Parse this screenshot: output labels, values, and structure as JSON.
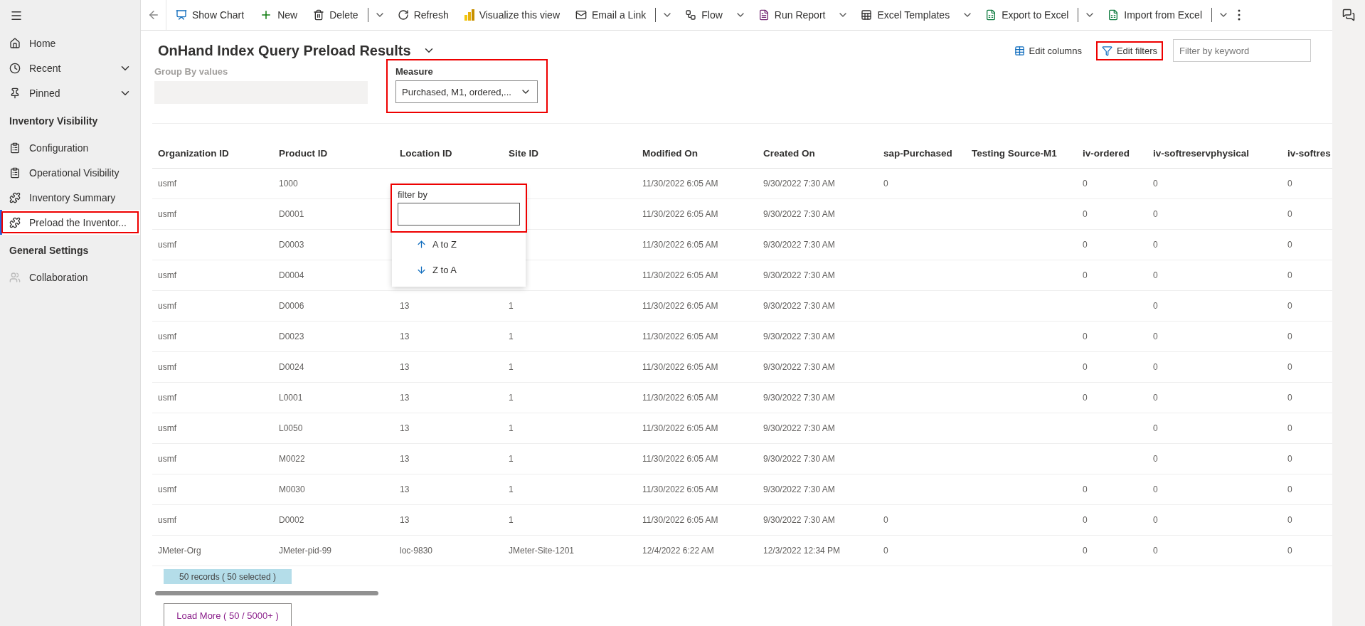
{
  "sidebar": {
    "items": [
      {
        "label": "Home",
        "expandable": false,
        "selected": false,
        "highlighted": false
      },
      {
        "label": "Recent",
        "expandable": true,
        "selected": false,
        "highlighted": false
      },
      {
        "label": "Pinned",
        "expandable": true,
        "selected": false,
        "highlighted": false
      }
    ],
    "sections": [
      {
        "title": "Inventory Visibility",
        "items": [
          {
            "label": "Configuration",
            "selected": false,
            "highlighted": false
          },
          {
            "label": "Operational Visibility",
            "selected": false,
            "highlighted": false
          },
          {
            "label": "Inventory Summary",
            "selected": false,
            "highlighted": false
          },
          {
            "label": "Preload the Inventor...",
            "selected": true,
            "highlighted": true
          }
        ]
      },
      {
        "title": "General Settings",
        "items": [
          {
            "label": "Collaboration",
            "selected": false,
            "highlighted": false
          }
        ]
      }
    ]
  },
  "toolbar": [
    {
      "label": "Show Chart",
      "caret": false,
      "divider": false
    },
    {
      "label": "New",
      "caret": false,
      "divider": false
    },
    {
      "label": "Delete",
      "caret": true,
      "divider": true
    },
    {
      "label": "Refresh",
      "caret": false,
      "divider": false
    },
    {
      "label": "Visualize this view",
      "caret": false,
      "divider": false
    },
    {
      "label": "Email a Link",
      "caret": true,
      "divider": true
    },
    {
      "label": "Flow",
      "caret": true,
      "divider": false
    },
    {
      "label": "Run Report",
      "caret": true,
      "divider": false
    },
    {
      "label": "Excel Templates",
      "caret": true,
      "divider": false
    },
    {
      "label": "Export to Excel",
      "caret": true,
      "divider": true
    },
    {
      "label": "Import from Excel",
      "caret": true,
      "divider": true
    }
  ],
  "view": {
    "title": "OnHand Index Query Preload Results",
    "edit_columns": "Edit columns",
    "edit_filters": {
      "label": "Edit filters",
      "highlighted": true
    },
    "search": {
      "placeholder": "Filter by keyword"
    }
  },
  "group_by": {
    "label": "Group By values",
    "disabled": true
  },
  "measure": {
    "label": "Measure",
    "value": "Purchased, M1, ordered,...",
    "highlighted": true
  },
  "table": {
    "columns": [
      "Organization ID",
      "Product ID",
      "Location ID",
      "Site ID",
      "Modified On",
      "Created On",
      "sap-Purchased",
      "Testing Source-M1",
      "iv-ordered",
      "iv-softreservphysical",
      "iv-softres"
    ],
    "rows": [
      {
        "cells": [
          "usmf",
          "1000",
          null,
          null,
          "11/30/2022 6:05 AM",
          "9/30/2022 7:30 AM",
          "0",
          null,
          "0",
          "0",
          "0"
        ]
      },
      {
        "cells": [
          "usmf",
          "D0001",
          null,
          null,
          "11/30/2022 6:05 AM",
          "9/30/2022 7:30 AM",
          null,
          null,
          "0",
          "0",
          "0"
        ]
      },
      {
        "cells": [
          "usmf",
          "D0003",
          null,
          null,
          "11/30/2022 6:05 AM",
          "9/30/2022 7:30 AM",
          null,
          null,
          "0",
          "0",
          "0"
        ]
      },
      {
        "cells": [
          "usmf",
          "D0004",
          null,
          null,
          "11/30/2022 6:05 AM",
          "9/30/2022 7:30 AM",
          null,
          null,
          "0",
          "0",
          "0"
        ]
      },
      {
        "cells": [
          "usmf",
          "D0006",
          "13",
          "1",
          "11/30/2022 6:05 AM",
          "9/30/2022 7:30 AM",
          null,
          null,
          null,
          "0",
          "0"
        ]
      },
      {
        "cells": [
          "usmf",
          "D0023",
          "13",
          "1",
          "11/30/2022 6:05 AM",
          "9/30/2022 7:30 AM",
          null,
          null,
          "0",
          "0",
          "0"
        ]
      },
      {
        "cells": [
          "usmf",
          "D0024",
          "13",
          "1",
          "11/30/2022 6:05 AM",
          "9/30/2022 7:30 AM",
          null,
          null,
          "0",
          "0",
          "0"
        ]
      },
      {
        "cells": [
          "usmf",
          "L0001",
          "13",
          "1",
          "11/30/2022 6:05 AM",
          "9/30/2022 7:30 AM",
          null,
          null,
          "0",
          "0",
          "0"
        ]
      },
      {
        "cells": [
          "usmf",
          "L0050",
          "13",
          "1",
          "11/30/2022 6:05 AM",
          "9/30/2022 7:30 AM",
          null,
          null,
          null,
          "0",
          "0"
        ]
      },
      {
        "cells": [
          "usmf",
          "M0022",
          "13",
          "1",
          "11/30/2022 6:05 AM",
          "9/30/2022 7:30 AM",
          null,
          null,
          null,
          "0",
          "0"
        ]
      },
      {
        "cells": [
          "usmf",
          "M0030",
          "13",
          "1",
          "11/30/2022 6:05 AM",
          "9/30/2022 7:30 AM",
          null,
          null,
          "0",
          "0",
          "0"
        ]
      },
      {
        "cells": [
          "usmf",
          "D0002",
          "13",
          "1",
          "11/30/2022 6:05 AM",
          "9/30/2022 7:30 AM",
          "0",
          null,
          "0",
          "0",
          "0"
        ]
      },
      {
        "cells": [
          "JMeter-Org",
          "JMeter-pid-99",
          "loc-9830",
          "JMeter-Site-1201",
          "12/4/2022 6:22 AM",
          "12/3/2022 12:34 PM",
          "0",
          null,
          "0",
          "0",
          "0"
        ]
      }
    ]
  },
  "column_menu": {
    "label": "filter by",
    "highlighted": true,
    "options": [
      "A to Z",
      "Z to A"
    ]
  },
  "footer": {
    "records": "50 records ( 50 selected )",
    "load_more": "Load More ( 50 / 5000+ )"
  }
}
